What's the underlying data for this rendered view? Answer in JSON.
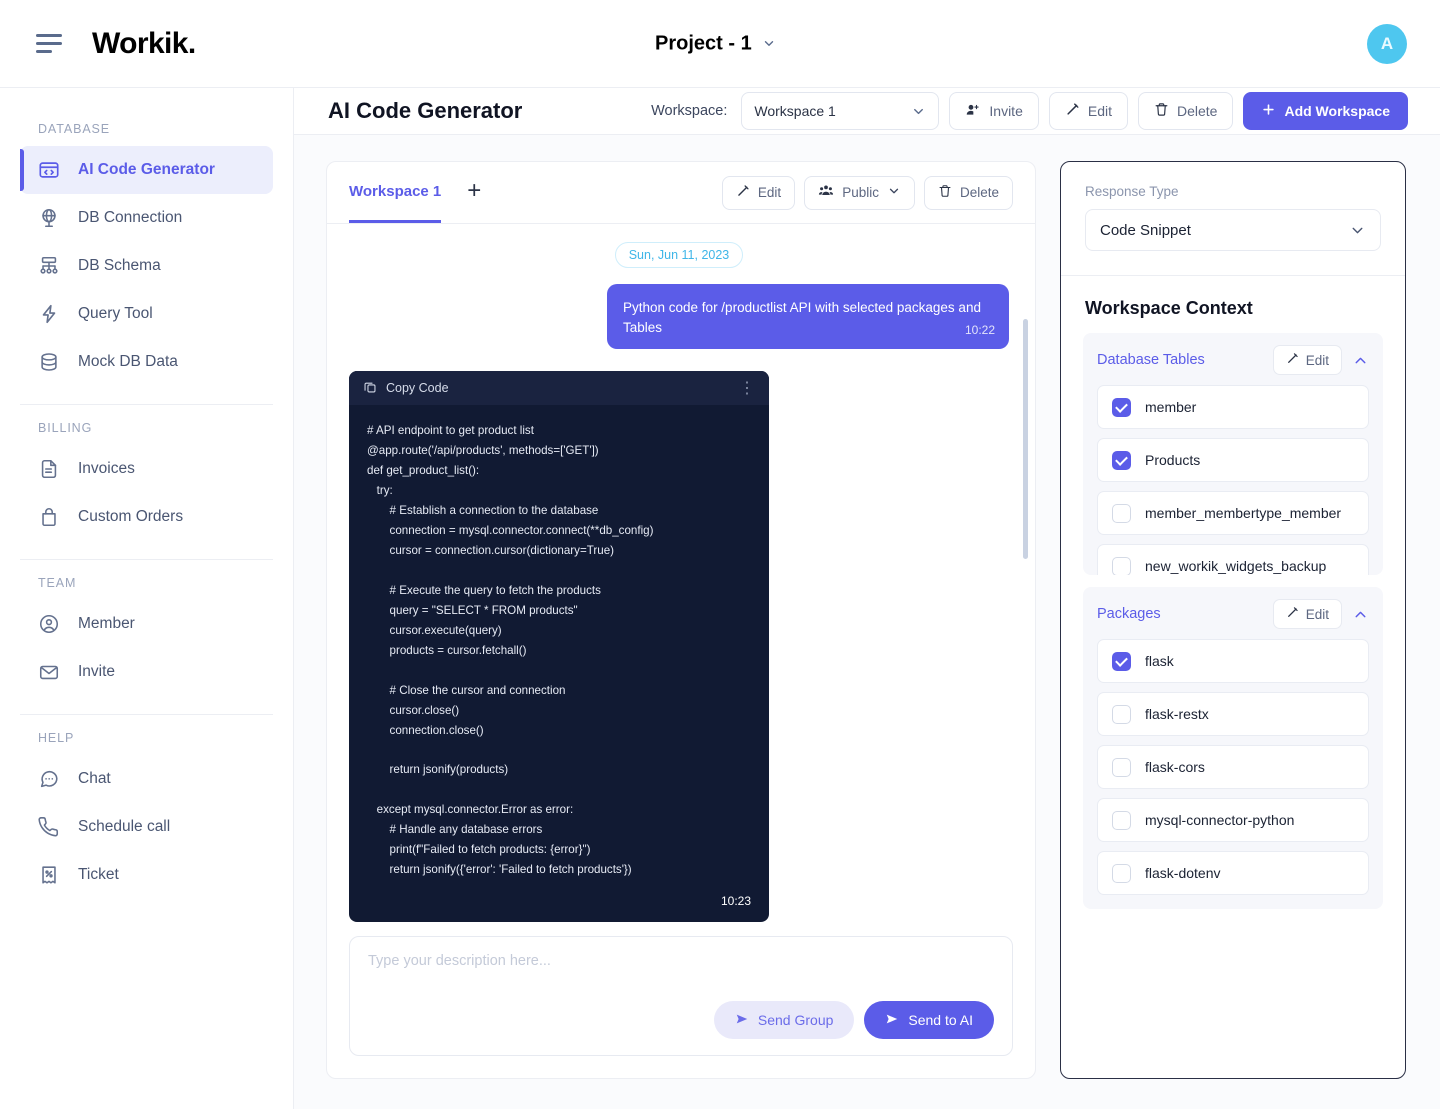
{
  "topbar": {
    "menu_icon": "hamburger-icon",
    "brand": "Workik.",
    "project": "Project - 1",
    "avatar_initial": "A"
  },
  "sidebar": {
    "groups": [
      {
        "label": "DATABASE",
        "items": [
          {
            "label": "AI Code Generator",
            "icon": "code-window-icon",
            "active": true
          },
          {
            "label": "DB Connection",
            "icon": "globe-icon",
            "active": false
          },
          {
            "label": "DB Schema",
            "icon": "schema-icon",
            "active": false
          },
          {
            "label": "Query Tool",
            "icon": "lightning-icon",
            "active": false
          },
          {
            "label": "Mock DB Data",
            "icon": "database-icon",
            "active": false
          }
        ]
      },
      {
        "label": "BILLING",
        "items": [
          {
            "label": "Invoices",
            "icon": "document-icon",
            "active": false
          },
          {
            "label": "Custom Orders",
            "icon": "bag-icon",
            "active": false
          }
        ]
      },
      {
        "label": "TEAM",
        "items": [
          {
            "label": "Member",
            "icon": "user-circle-icon",
            "active": false
          },
          {
            "label": "Invite",
            "icon": "envelope-icon",
            "active": false
          }
        ]
      },
      {
        "label": "HELP",
        "items": [
          {
            "label": "Chat",
            "icon": "chat-bubble-icon",
            "active": false
          },
          {
            "label": "Schedule call",
            "icon": "phone-icon",
            "active": false
          },
          {
            "label": "Ticket",
            "icon": "ticket-icon",
            "active": false
          }
        ]
      }
    ]
  },
  "main_header": {
    "title": "AI Code Generator",
    "workspace_label": "Workspace:",
    "workspace_value": "Workspace 1",
    "invite_label": "Invite",
    "edit_label": "Edit",
    "delete_label": "Delete",
    "add_workspace_label": "Add Workspace"
  },
  "chat": {
    "tab_label": "Workspace 1",
    "add_tab_label": "+",
    "edit_label": "Edit",
    "visibility_label": "Public",
    "delete_label": "Delete",
    "date_chip": "Sun, Jun 11, 2023",
    "user_message": "Python code for /productlist API with selected packages and Tables",
    "user_message_time": "10:22",
    "code_header_label": "Copy Code",
    "code_time": "10:23",
    "code": "# API endpoint to get product list\n@app.route('/api/products', methods=['GET'])\ndef get_product_list():\n   try:\n       # Establish a connection to the database\n       connection = mysql.connector.connect(**db_config)\n       cursor = connection.cursor(dictionary=True)\n\n       # Execute the query to fetch the products\n       query = \"SELECT * FROM products\"\n       cursor.execute(query)\n       products = cursor.fetchall()\n\n       # Close the cursor and connection\n       cursor.close()\n       connection.close()\n\n       return jsonify(products)\n\n   except mysql.connector.Error as error:\n       # Handle any database errors\n       print(f\"Failed to fetch products: {error}\")\n       return jsonify({'error': 'Failed to fetch products'})"
  },
  "composer": {
    "placeholder": "Type your description here...",
    "send_group_label": "Send Group",
    "send_ai_label": "Send to AI"
  },
  "right_panel": {
    "response_type_label": "Response Type",
    "response_type_value": "Code Snippet",
    "context_title": "Workspace Context",
    "sections": [
      {
        "name": "Database Tables",
        "edit_label": "Edit",
        "items": [
          {
            "label": "member",
            "checked": true
          },
          {
            "label": "Products",
            "checked": true
          },
          {
            "label": "member_membertype_member",
            "checked": false
          },
          {
            "label": "new_workik_widgets_backup",
            "checked": false
          },
          {
            "label": "",
            "checked": false
          }
        ]
      },
      {
        "name": "Packages",
        "edit_label": "Edit",
        "items": [
          {
            "label": "flask",
            "checked": true
          },
          {
            "label": "flask-restx",
            "checked": false
          },
          {
            "label": "flask-cors",
            "checked": false
          },
          {
            "label": "mysql-connector-python",
            "checked": false
          },
          {
            "label": "flask-dotenv",
            "checked": false
          }
        ]
      }
    ]
  },
  "colors": {
    "accent": "#5b5ce8",
    "avatar": "#4ec7ef",
    "date_chip_text": "#3fb6e8",
    "code_bg": "#111a33",
    "code_head_bg": "#1a2340"
  }
}
